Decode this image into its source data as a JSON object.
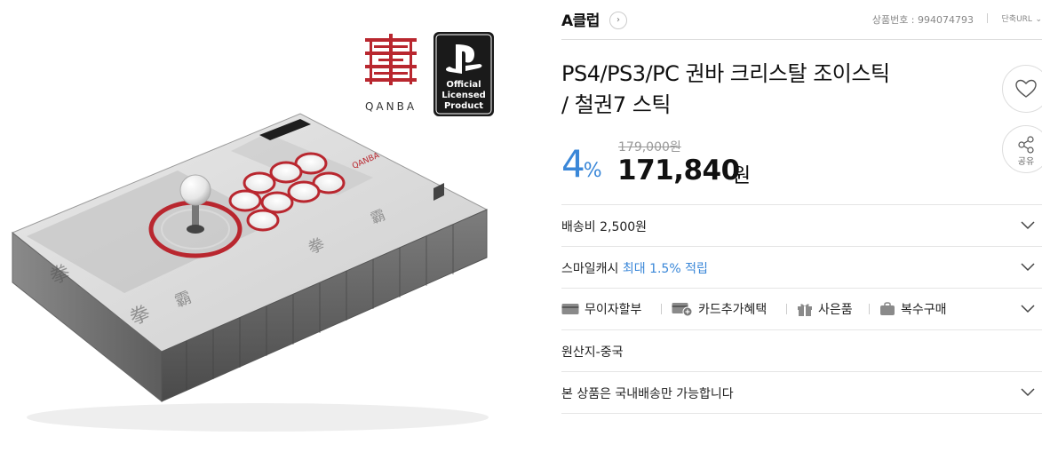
{
  "header": {
    "club_label": "A클럽",
    "club_arrow": "›",
    "product_number": "상품번호 : 994074793",
    "short_url": "단축URL",
    "short_url_icon": "⌄"
  },
  "product": {
    "title_line1": "PS4/PS3/PC 권바 크리스탈 조이스틱",
    "title_line2": "/ 철권7 스틱",
    "original_price": "179,000원",
    "discount_number": "4",
    "discount_unit": "%",
    "price": "171,840",
    "currency": "원"
  },
  "actions": {
    "share_label": "공유",
    "heart_icon": "heart-icon",
    "share_icon": "share-icon"
  },
  "rows": {
    "shipping": "배송비 2,500원",
    "smile_cash_prefix": "스마일캐시 ",
    "smile_cash_highlight": "최대 1.5% 적립",
    "origin": "원산지-중국",
    "domestic": "본 상품은 국내배송만 가능합니다"
  },
  "benefits": {
    "installment": "무이자할부",
    "card": "카드추가혜택",
    "gift": "사은품",
    "multi": "복수구매"
  },
  "image": {
    "brand": "QANBA",
    "ps_logo_text_1": "Official",
    "ps_logo_text_2": "Licensed",
    "ps_logo_text_3": "Product",
    "ps_logo_alt": "PlayStation Official Licensed Product logo",
    "stick_label": "QANBA"
  },
  "colors": {
    "accent": "#3a87d8",
    "qanba_red": "#b9272f"
  }
}
